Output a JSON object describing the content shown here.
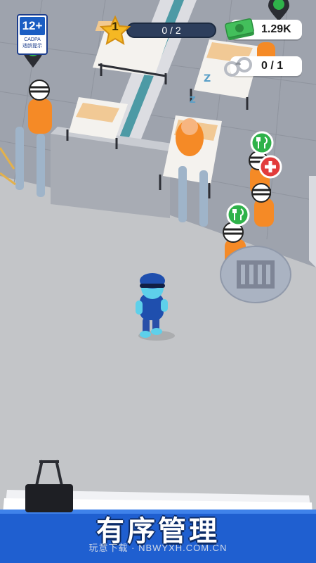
{
  "age_rating": {
    "rating": "12+",
    "org": "CADPA",
    "hint": "适龄提示"
  },
  "hud": {
    "level": "1",
    "progress": "0 / 2",
    "money": "1.29K",
    "prisoners": "0 / 1"
  },
  "icons": {
    "level": "star-icon",
    "money": "cash-icon",
    "prisoners": "handcuffs-icon",
    "food": "fork-knife-icon",
    "medical": "red-cross-icon",
    "sleep": "zzz-icon",
    "cell": "cell-door-icon"
  },
  "colors": {
    "accent": "#f5b823",
    "prisoner": "#f58a26",
    "guard": "#1f4fae",
    "food_bubble": "#2fb24a",
    "medical_bubble": "#e23b3b"
  },
  "banner": {
    "title": "有序管理",
    "watermark": "玩意下载 · NBWYXH.COM.CN"
  }
}
